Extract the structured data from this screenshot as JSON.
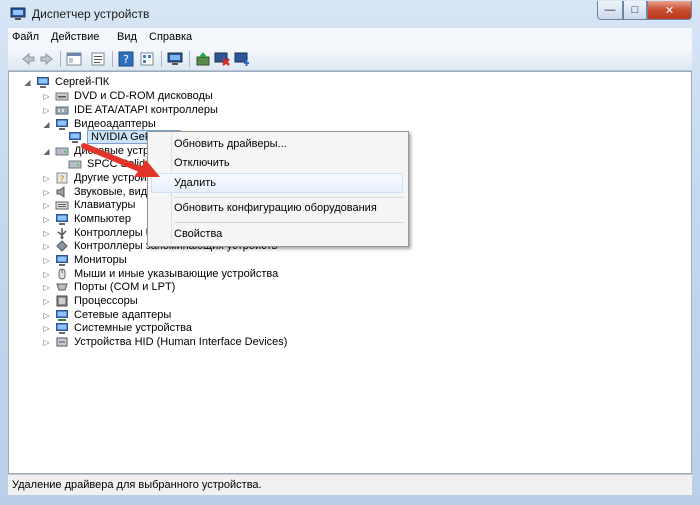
{
  "window": {
    "title": "Диспетчер устройств",
    "controls": {
      "minimize": "—",
      "maximize": "□",
      "close": "✕"
    }
  },
  "menu": [
    "Файл",
    "Действие",
    "Вид",
    "Справка"
  ],
  "tree": {
    "root": "Сергей-ПК",
    "items": [
      "DVD и CD-ROM дисководы",
      "IDE ATA/ATAPI контроллеры",
      "Видеоадаптеры",
      "NVIDIA GeFor",
      "Дисковые устро",
      "SPCC Solid St",
      "Другие устройс",
      "Звуковые, видео",
      "Клавиатуры",
      "Компьютер",
      "Контроллеры USB",
      "Контроллеры запоминающих устройств",
      "Мониторы",
      "Мыши и иные указывающие устройства",
      "Порты (COM и LPT)",
      "Процессоры",
      "Сетевые адаптеры",
      "Системные устройства",
      "Устройства HID (Human Interface Devices)"
    ]
  },
  "context_menu": {
    "update_drivers": "Обновить драйверы...",
    "disable": "Отключить",
    "uninstall": "Удалить",
    "scan": "Обновить конфигурацию оборудования",
    "properties": "Свойства"
  },
  "status": "Удаление драйвера для выбранного устройства.",
  "colors": {
    "selection": "#cde3f7",
    "arrow": "#e3342a",
    "frame": "#c4d8ee"
  }
}
